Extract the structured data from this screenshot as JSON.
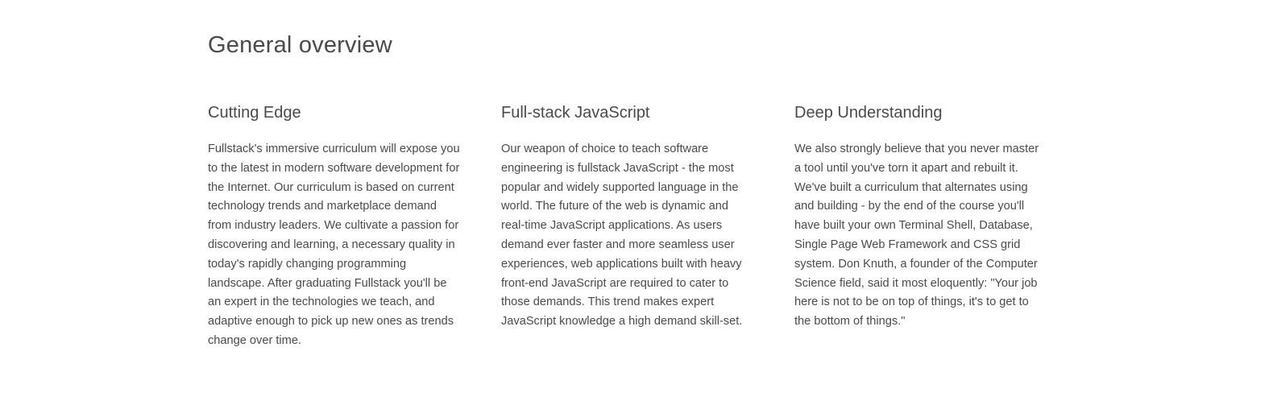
{
  "overview": {
    "title": "General overview",
    "columns": [
      {
        "heading": "Cutting Edge",
        "body": "Fullstack's immersive curriculum will expose you to the latest in modern software development for the Internet. Our curriculum is based on current technology trends and marketplace demand from industry leaders. We cultivate a passion for discovering and learning, a necessary quality in today's rapidly changing programming landscape. After graduating Fullstack you'll be an expert in the technologies we teach, and adaptive enough to pick up new ones as trends change over time."
      },
      {
        "heading": "Full-stack JavaScript",
        "body": "Our weapon of choice to teach software engineering is fullstack JavaScript - the most popular and widely supported language in the world. The future of the web is dynamic and real-time JavaScript applications. As users demand ever faster and more seamless user experiences, web applications built with heavy front-end JavaScript are required to cater to those demands. This trend makes expert JavaScript knowledge a high demand skill-set."
      },
      {
        "heading": "Deep Understanding",
        "body": "We also strongly believe that you never master a tool until you've torn it apart and rebuilt it. We've built a curriculum that alternates using and building - by the end of the course you'll have built your own Terminal Shell, Database, Single Page Web Framework and CSS grid system. Don Knuth, a founder of the Computer Science field, said it most eloquently: \"Your job here is not to be on top of things, it's to get to the bottom of things.\""
      }
    ]
  }
}
